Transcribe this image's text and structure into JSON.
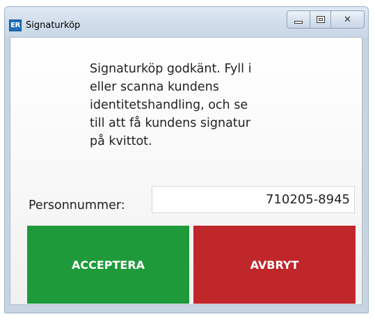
{
  "window": {
    "app_icon_text": "ER",
    "title": "Signaturköp",
    "controls": {
      "minimize_icon": "minimize-icon",
      "maximize_icon": "maximize-icon",
      "close_icon": "close-icon",
      "close_glyph": "✕"
    }
  },
  "dialog": {
    "message": "Signaturköp godkänt. Fyll i\neller scanna kundens\nidentitetshandling, och se\ntill att få kundens signatur\npå kvittot.",
    "personnummer_label": "Personnummer:",
    "personnummer_value": "710205-8945",
    "accept_label": "ACCEPTERA",
    "cancel_label": "AVBRYT"
  },
  "colors": {
    "accept": "#1f9a3a",
    "cancel": "#c0272b",
    "title_bar": "#d3dfec"
  }
}
